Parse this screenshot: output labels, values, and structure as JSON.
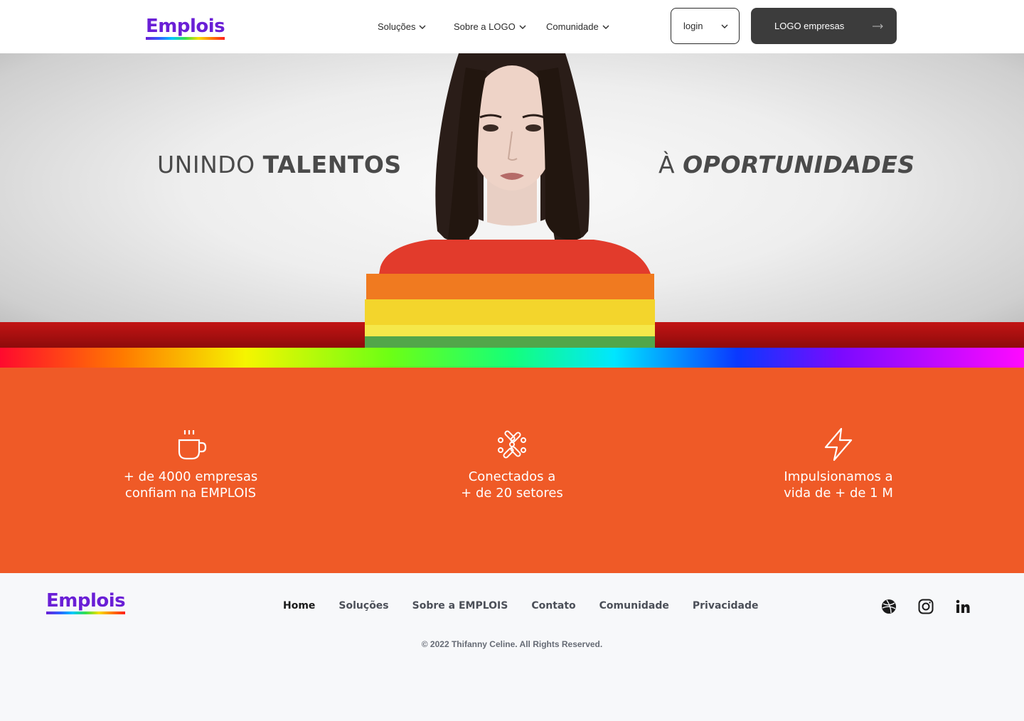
{
  "header": {
    "logo": "Emplois",
    "nav": [
      {
        "label": "Soluções"
      },
      {
        "label": "Sobre a LOGO"
      },
      {
        "label": "Comunidade"
      }
    ],
    "login_label": "login",
    "companies_button": "LOGO empresas"
  },
  "hero": {
    "left_text_plain": "UNINDO ",
    "left_text_bold": "TALENTOS",
    "right_text_plain": "À ",
    "right_text_bold": "OPORTUNIDADES"
  },
  "stats": [
    {
      "icon": "coffee-cup-icon",
      "line1": "+ de 4000 empresas",
      "line2": "confiam na EMPLOIS"
    },
    {
      "icon": "network-icon",
      "line1": "Conectados a",
      "line2": "+ de 20 setores"
    },
    {
      "icon": "lightning-icon",
      "line1": "Impulsionamos a",
      "line2": "vida de + de 1 M"
    }
  ],
  "footer": {
    "logo": "Emplois",
    "nav": [
      "Home",
      "Soluções",
      "Sobre a EMPLOIS",
      "Contato",
      "Comunidade",
      "Privacidade"
    ],
    "social": [
      "dribbble-icon",
      "instagram-icon",
      "linkedin-icon"
    ],
    "copyright": "© 2022 Thifanny Celine. All Rights Reserved."
  },
  "colors": {
    "brand_purple": "#6a1fd6",
    "stats_orange": "#ef5a27",
    "dark_button": "#3c3c3c"
  }
}
